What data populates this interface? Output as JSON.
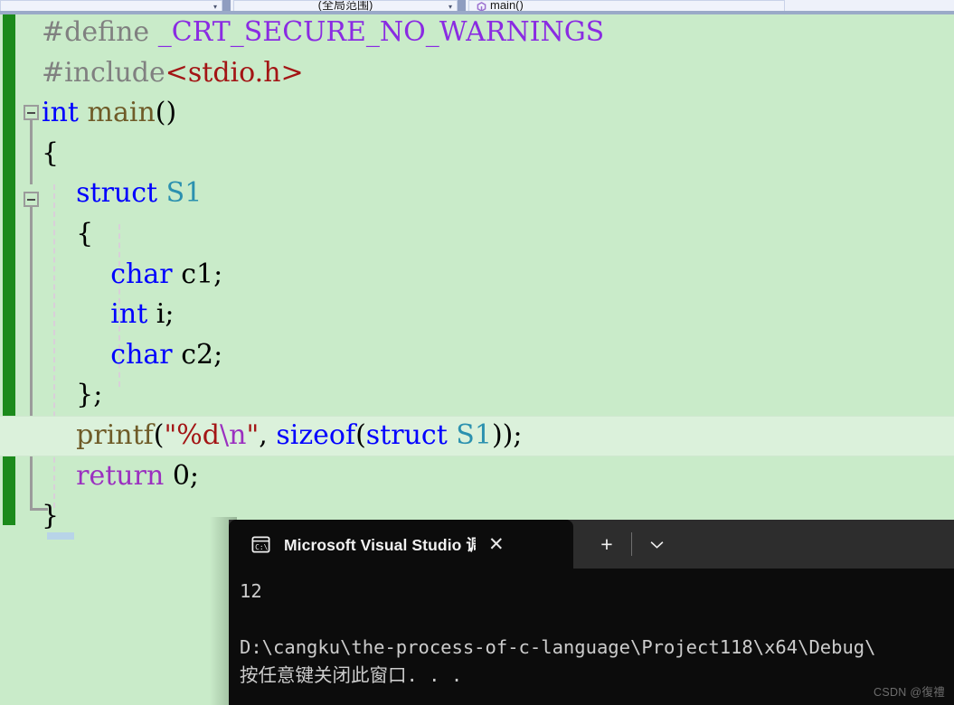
{
  "navbar": {
    "project_scope": "",
    "scope": "(全局范围)",
    "member": "main()",
    "member_icon": "method-icon",
    "caret_icon": "chevron-down-icon"
  },
  "editor": {
    "background_color": "#C9EBC9",
    "change_bar_color": "#1B8A1B",
    "current_line_highlight_color": "#DBF1DB",
    "lines": [
      {
        "id": "line-define",
        "tokens": [
          {
            "text": "#define ",
            "kind": "pre"
          },
          {
            "text": "_CRT_SECURE_NO_WARNINGS",
            "kind": "macro"
          }
        ]
      },
      {
        "id": "line-include",
        "tokens": [
          {
            "text": "#include",
            "kind": "pre"
          },
          {
            "text": "<stdio.h>",
            "kind": "str"
          }
        ]
      },
      {
        "id": "line-main",
        "tokens": [
          {
            "text": "int ",
            "kind": "kw"
          },
          {
            "text": "main",
            "kind": "fn"
          },
          {
            "text": "()",
            "kind": "plain"
          }
        ]
      },
      {
        "id": "line-main-open",
        "tokens": [
          {
            "text": "{",
            "kind": "plain"
          }
        ]
      },
      {
        "id": "line-struct",
        "tokens": [
          {
            "text": "    struct ",
            "kind": "kw"
          },
          {
            "text": "S1",
            "kind": "type"
          }
        ]
      },
      {
        "id": "line-struct-open",
        "tokens": [
          {
            "text": "    {",
            "kind": "plain"
          }
        ]
      },
      {
        "id": "line-c1",
        "tokens": [
          {
            "text": "        char ",
            "kind": "kw"
          },
          {
            "text": "c1;",
            "kind": "plain"
          }
        ]
      },
      {
        "id": "line-i",
        "tokens": [
          {
            "text": "        int ",
            "kind": "kw"
          },
          {
            "text": "i;",
            "kind": "plain"
          }
        ]
      },
      {
        "id": "line-c2",
        "tokens": [
          {
            "text": "        char ",
            "kind": "kw"
          },
          {
            "text": "c2;",
            "kind": "plain"
          }
        ]
      },
      {
        "id": "line-struct-close",
        "tokens": [
          {
            "text": "    };",
            "kind": "plain"
          }
        ]
      },
      {
        "id": "line-printf",
        "highlight": true,
        "tokens": [
          {
            "text": "    ",
            "kind": "plain"
          },
          {
            "text": "printf",
            "kind": "fn"
          },
          {
            "text": "(",
            "kind": "plain"
          },
          {
            "text": "\"%d",
            "kind": "str"
          },
          {
            "text": "\\n",
            "kind": "esc"
          },
          {
            "text": "\"",
            "kind": "str"
          },
          {
            "text": ", ",
            "kind": "plain"
          },
          {
            "text": "sizeof",
            "kind": "kw"
          },
          {
            "text": "(",
            "kind": "plain"
          },
          {
            "text": "struct ",
            "kind": "kw"
          },
          {
            "text": "S1",
            "kind": "type"
          },
          {
            "text": "));",
            "kind": "plain"
          }
        ]
      },
      {
        "id": "line-return",
        "tokens": [
          {
            "text": "    return ",
            "kind": "ctl"
          },
          {
            "text": "0;",
            "kind": "plain"
          }
        ]
      },
      {
        "id": "line-main-close",
        "tokens": [
          {
            "text": "}",
            "kind": "plain"
          }
        ]
      }
    ]
  },
  "console": {
    "tab_title": "Microsoft Visual Studio 调试控",
    "tab_icon": "terminal-cmd-icon",
    "close_label": "✕",
    "new_tab_label": "+",
    "dropdown_label": "⌄",
    "output_lines": [
      "12",
      "",
      "D:\\cangku\\the-process-of-c-language\\Project118\\x64\\Debug\\",
      "按任意键关闭此窗口. . ."
    ],
    "background_color": "#0C0C0C",
    "titlebar_color": "#2D2D2D",
    "text_color": "#CCCCCC"
  },
  "watermark": {
    "text": "CSDN @復禮"
  }
}
